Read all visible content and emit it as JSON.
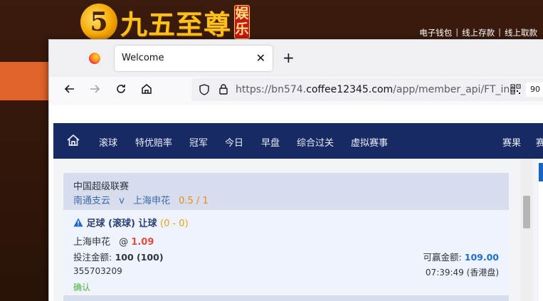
{
  "background": {
    "logo_mark": "5",
    "logo_text": "九五至尊",
    "logo_badge": "娱乐",
    "top_nav": [
      "电子钱包",
      "线上存款",
      "线上取款"
    ]
  },
  "browser": {
    "tab_title": "Welcome",
    "url_prefix": "https://bn574.",
    "url_domain": "coffee12345.com",
    "url_path": "/app/member_api/FT_ind",
    "zoom": "90"
  },
  "site_nav": {
    "items": [
      "滚球",
      "特优赔率",
      "冠军",
      "今日",
      "早盘",
      "综合过关",
      "虚拟赛事"
    ],
    "right_items": [
      "赛果",
      "赛"
    ]
  },
  "bet": {
    "league": "中国超级联赛",
    "home_team": "南通支云",
    "vs": "v",
    "away_team": "上海申花",
    "handicap": "0.5 / 1",
    "title_icon": "warning-icon",
    "title": "足球 (滚球) 让球",
    "score": "(0 - 0)",
    "pick_team": "上海申花",
    "at": "@",
    "odds": "1.09",
    "stake_label": "投注金额:",
    "stake_value": "100 (100)",
    "win_label": "可赢金额:",
    "win_value": "109.00",
    "ticket_id": "355703209",
    "time": "07:39:49 (香港盘)",
    "status": "确认"
  },
  "colors": {
    "nav_bg": "#172a63",
    "handicap": "#e88b1b",
    "odds": "#e14b3b",
    "win_amount": "#1e6fd1",
    "status": "#4bb13c"
  }
}
